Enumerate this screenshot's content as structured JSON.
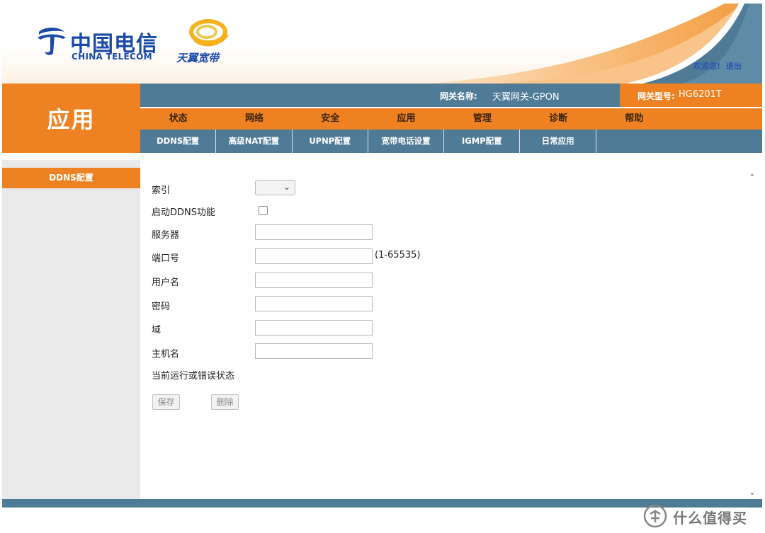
{
  "header": {
    "brand_cn": "中国电信",
    "brand_en": "CHINA TELECOM",
    "sub_brand": "天翼宽带",
    "welcome": "欢迎您!",
    "logout": "退出"
  },
  "app_title": "应用",
  "gateway": {
    "name_label": "网关名称:",
    "name_value": "天翼网关-GPON",
    "model_label": "网关型号:",
    "model_value": "HG6201T"
  },
  "main_nav": [
    "状态",
    "网络",
    "安全",
    "应用",
    "管理",
    "诊断",
    "帮助"
  ],
  "sub_nav": [
    "DDNS配置",
    "高级NAT配置",
    "UPNP配置",
    "宽带电话设置",
    "IGMP配置",
    "日常应用"
  ],
  "sidebar": {
    "items": [
      {
        "label": "DDNS配置"
      }
    ]
  },
  "form": {
    "index_label": "索引",
    "enable_label": "启动DDNS功能",
    "server_label": "服务器",
    "port_label": "端口号",
    "port_hint": "(1-65535)",
    "username_label": "用户名",
    "password_label": "密码",
    "domain_label": "域",
    "hostname_label": "主机名",
    "status_label": "当前运行或错误状态",
    "server_value": "",
    "port_value": "",
    "username_value": "",
    "password_value": "",
    "domain_value": "",
    "hostname_value": "",
    "index_value": "",
    "enable_checked": false
  },
  "buttons": {
    "save": "保存",
    "delete": "删除"
  },
  "watermark": {
    "text": "什么值得买"
  },
  "colors": {
    "orange": "#ee8121",
    "steel_blue": "#4f7b97",
    "brand_blue": "#1a4aa8",
    "sidebar_gray": "#e9e9e9"
  },
  "icons": [
    "china-telecom-logo-icon",
    "tianyi-logo-icon",
    "chevron-down-icon",
    "scroll-up-icon",
    "scroll-down-icon",
    "watermark-logo-icon"
  ]
}
